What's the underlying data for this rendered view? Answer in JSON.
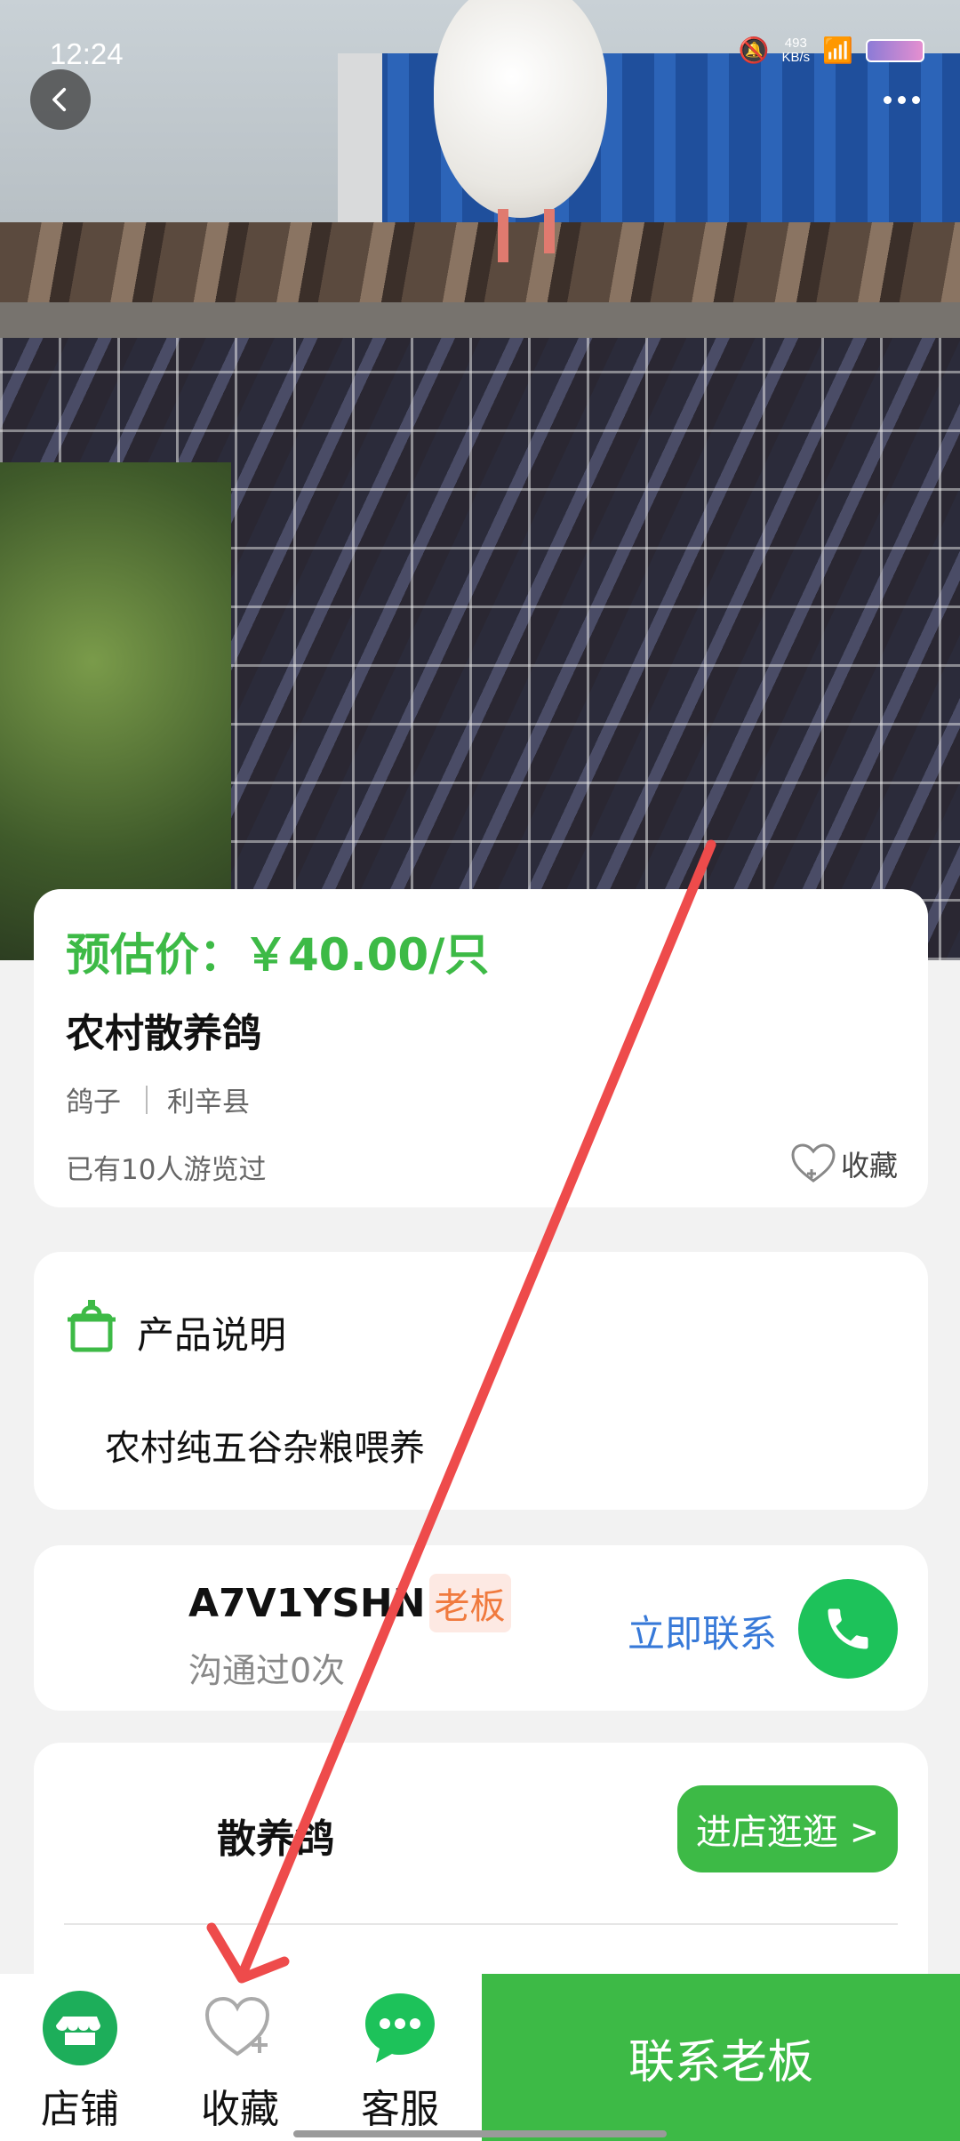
{
  "status_bar": {
    "time": "12:24",
    "speed_value": "493",
    "speed_unit": "KB/s"
  },
  "nav": {
    "back_icon": "chevron-left-icon",
    "more_icon": "more-dots-icon"
  },
  "product": {
    "price_text": "预估价：￥40.00/只",
    "title": "农村散养鸽",
    "category": "鸽子",
    "location": "利辛县",
    "views_text": "已有10人游览过",
    "favorite_label": "收藏"
  },
  "description": {
    "heading": "产品说明",
    "text": "农村纯五谷杂粮喂养"
  },
  "seller": {
    "name": "A7V1YSHN",
    "badge": "老板",
    "sub_text": "沟通过0次",
    "contact_label": "立即联系"
  },
  "shop": {
    "name": "散养鸽",
    "enter_label": "进店逛逛 >"
  },
  "bottom_bar": {
    "shop_label": "店铺",
    "favorite_label": "收藏",
    "service_label": "客服",
    "contact_boss_label": "联系老板"
  },
  "colors": {
    "accent_green": "#3dba46",
    "phone_green": "#1dc25a",
    "link_blue": "#3779d8",
    "badge_orange": "#f07a3e",
    "annotation_red": "#ee4b4b"
  }
}
